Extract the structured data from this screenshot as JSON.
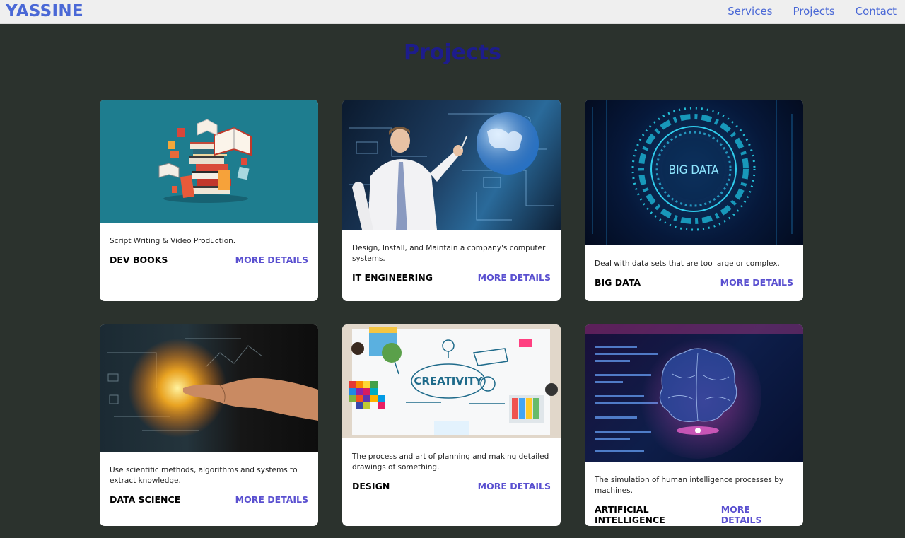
{
  "navbar": {
    "logo": "YASSINE",
    "links": [
      "Services",
      "Projects",
      "Contact"
    ]
  },
  "page": {
    "title": "Projects"
  },
  "cards": [
    {
      "description": "Script Writing & Video Production.",
      "name": "DEV BOOKS",
      "more": "MORE DETAILS",
      "image": "books-illustration"
    },
    {
      "description": "Design, Install, and Maintain a company's computer systems.",
      "name": "IT ENGINEERING",
      "more": "MORE DETAILS",
      "image": "engineer-globe-photo"
    },
    {
      "description": "Deal with data sets that are too large or complex.",
      "name": "BIG DATA",
      "more": "MORE DETAILS",
      "image": "big-data-ring",
      "image_text": "BIG DATA"
    },
    {
      "description": "Use scientific methods, algorithms and systems to extract knowledge.",
      "name": "DATA SCIENCE",
      "more": "MORE DETAILS",
      "image": "hand-touching-data-photo"
    },
    {
      "description": "The process and art of planning and making detailed drawings of something.",
      "name": "DESIGN",
      "more": "MORE DETAILS",
      "image": "creativity-desk-photo",
      "image_text": "CREATIVITY"
    },
    {
      "description": "The simulation of human intelligence processes by machines.",
      "name": "ARTIFICIAL INTELLIGENCE",
      "more": "MORE DETAILS",
      "image": "ai-brain-photo"
    }
  ]
}
